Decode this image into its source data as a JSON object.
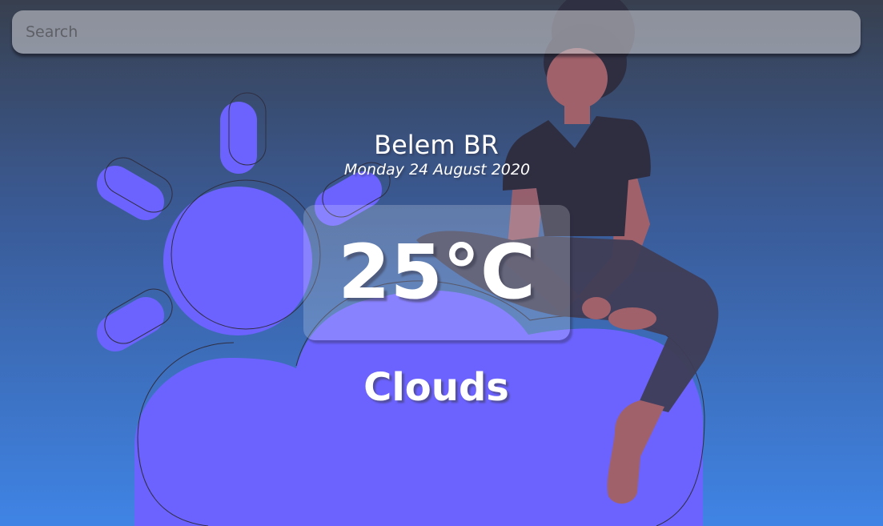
{
  "search": {
    "placeholder": "Search",
    "value": ""
  },
  "weather": {
    "location": "Belem BR",
    "date": "Monday 24 August 2020",
    "temperature": "25°C",
    "condition": "Clouds"
  },
  "icons": {
    "background": "sun-cloud-person-illustration"
  },
  "colors": {
    "gradient_top": "#38404f",
    "gradient_bottom": "#3f84e5",
    "illustration_accent": "#6c63ff"
  }
}
